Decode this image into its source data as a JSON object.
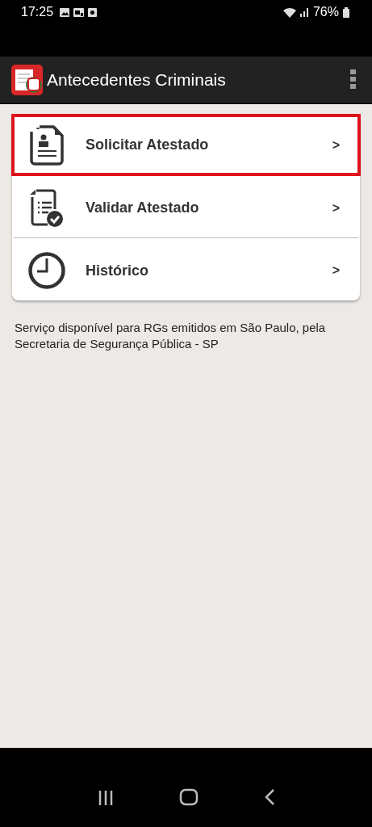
{
  "status_bar": {
    "time": "17:25",
    "battery": "76%"
  },
  "app_bar": {
    "title": "Antecedentes Criminais"
  },
  "menu": [
    {
      "kind": "document",
      "label": "Solicitar Atestado",
      "chevron": ">",
      "selected": true
    },
    {
      "kind": "checklist",
      "label": "Validar Atestado",
      "chevron": ">",
      "selected": false
    },
    {
      "kind": "clock",
      "label": "Histórico",
      "chevron": ">",
      "selected": false
    }
  ],
  "notice": "Serviço disponível para RGs emitidos em São Paulo, pela Secretaria de Segurança Pública - SP"
}
